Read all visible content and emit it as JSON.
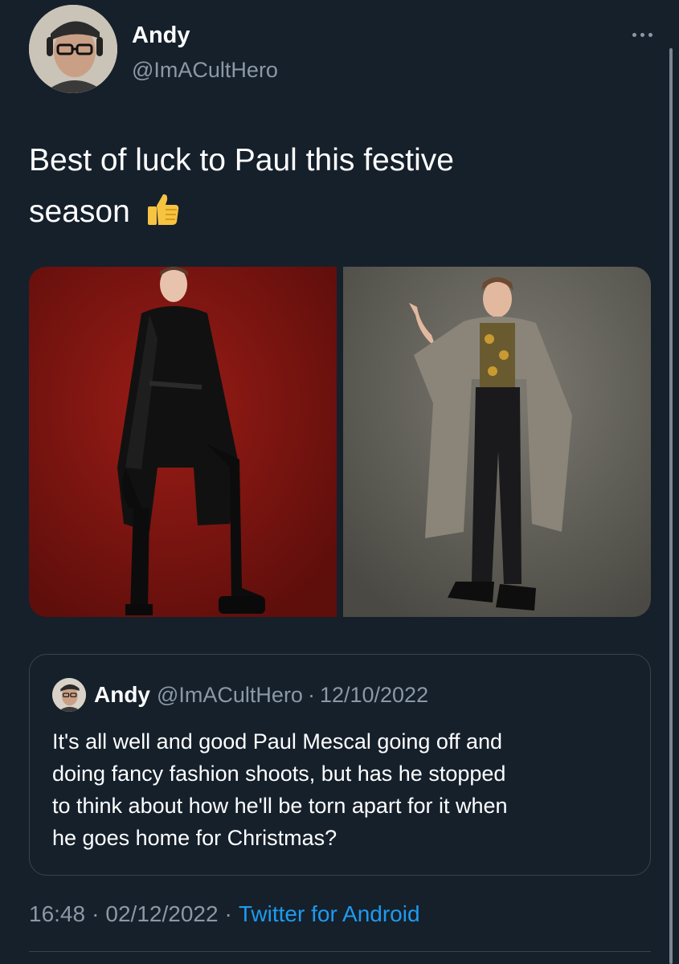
{
  "tweet": {
    "author": {
      "name": "Andy",
      "handle": "@ImACultHero",
      "avatar_icon": "profile-photo-man-glasses-cap-headphones"
    },
    "text_line1": "Best of luck to Paul this festive",
    "text_line2": "season",
    "emoji": "thumbs-up",
    "more_icon": "ellipsis-icon",
    "media": [
      {
        "description_icon": "photo-leather-coat-red-backdrop",
        "background": "#7a1410"
      },
      {
        "description_icon": "photo-tweed-coat-grey-backdrop",
        "background": "#6b6a62"
      }
    ],
    "quoted": {
      "name": "Andy",
      "handle": "@ImACultHero",
      "separator": "·",
      "date": "12/10/2022",
      "lines": [
        "It's all well and good Paul Mescal going off and",
        "doing fancy fashion shoots, but has he stopped",
        "to think about how he'll be torn apart for it when",
        "he goes home for Christmas?"
      ]
    },
    "meta": {
      "time": "16:48",
      "separator": "·",
      "date": "02/12/2022",
      "source": "Twitter for Android"
    }
  },
  "colors": {
    "background": "#15202b",
    "text": "#ffffff",
    "secondary": "#8b98a5",
    "link": "#1d9bf0",
    "border": "#38444d"
  }
}
